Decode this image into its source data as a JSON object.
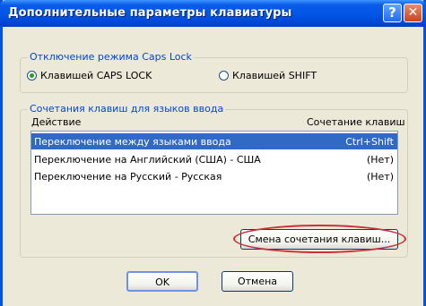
{
  "window": {
    "title": "Дополнительные параметры клавиатуры",
    "help_symbol": "?",
    "close_symbol": "✕"
  },
  "caps_lock": {
    "group_title": "Отключение режима Caps Lock",
    "options": [
      {
        "label": "Клавишей CAPS LOCK",
        "checked": true
      },
      {
        "label": "Клавишей SHIFT",
        "checked": false
      }
    ]
  },
  "hotkeys": {
    "group_title": "Сочетания клавиш для языков ввода",
    "columns": {
      "action": "Действие",
      "combination": "Сочетание клавиш"
    },
    "rows": [
      {
        "action": "Переключение между языками ввода",
        "combination": "Ctrl+Shift",
        "selected": true
      },
      {
        "action": "Переключение на Английский (США) - США",
        "combination": "(Нет)",
        "selected": false
      },
      {
        "action": "Переключение на Русский - Русская",
        "combination": "(Нет)",
        "selected": false
      }
    ],
    "change_button": "Смена сочетания клавиш..."
  },
  "buttons": {
    "ok": "OK",
    "cancel": "Отмена"
  },
  "colors": {
    "selection": "#316ac5",
    "highlight_ellipse": "#c8323a",
    "titlebar": "#0055e5"
  }
}
